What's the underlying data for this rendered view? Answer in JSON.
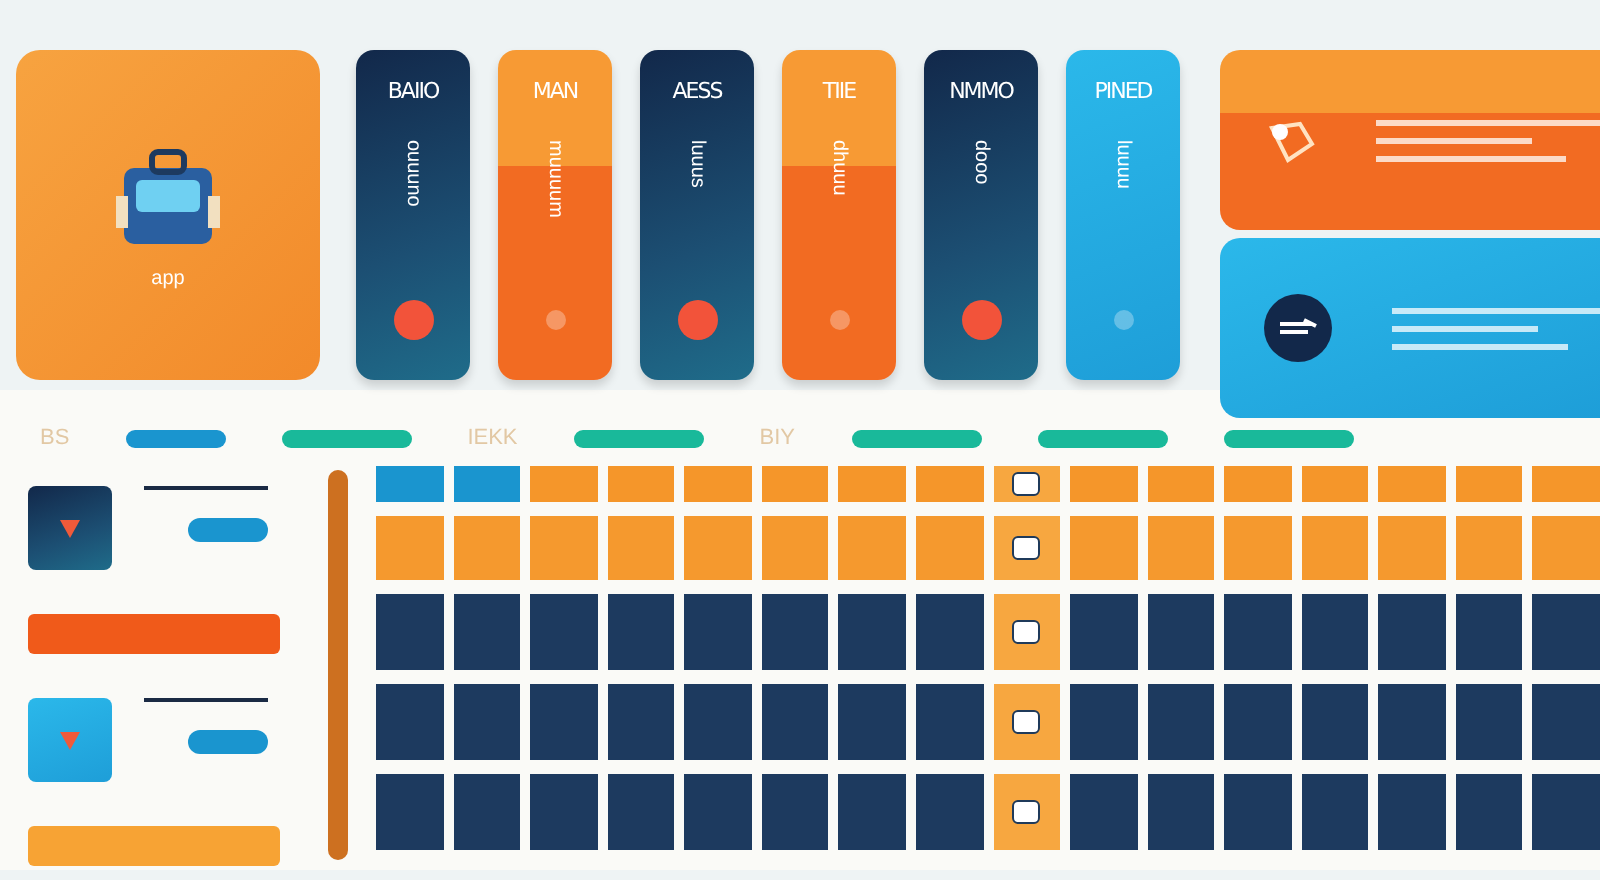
{
  "feature_card": {
    "title": "app"
  },
  "cards": [
    {
      "title": "BAIIO",
      "caption": "ouuuno",
      "kind": "navy",
      "active": true
    },
    {
      "title": "MAN",
      "caption": "muuuum",
      "kind": "orange",
      "active": false
    },
    {
      "title": "AESS",
      "caption": "luuus",
      "kind": "navy",
      "active": true
    },
    {
      "title": "TIIE",
      "caption": "dhuuu",
      "kind": "orange",
      "active": false
    },
    {
      "title": "NMMO",
      "caption": "dooo",
      "kind": "navy",
      "active": true
    },
    {
      "title": "PINED",
      "caption": "luuuu",
      "kind": "sky",
      "active": false
    }
  ],
  "panels": [
    {
      "kind": "orange"
    },
    {
      "kind": "sky"
    }
  ],
  "filter_bar": [
    {
      "kind": "label",
      "text": "BS"
    },
    {
      "kind": "pill",
      "selected": true
    },
    {
      "kind": "pill",
      "selected": false
    },
    {
      "kind": "label",
      "text": "IEKK"
    },
    {
      "kind": "pill",
      "selected": false
    },
    {
      "kind": "label",
      "text": "BIY"
    },
    {
      "kind": "pill",
      "selected": false
    },
    {
      "kind": "pill",
      "selected": false
    },
    {
      "kind": "pill",
      "selected": false
    }
  ],
  "sidebar": {
    "items": [
      {
        "kind": "navytile"
      },
      {
        "kind": "redbar"
      },
      {
        "kind": "skytile"
      },
      {
        "kind": "amberbar"
      }
    ]
  },
  "grid": {
    "rows": [
      {
        "kind": "head"
      },
      {
        "kind": "accent"
      },
      {
        "kind": "data"
      },
      {
        "kind": "data"
      },
      {
        "kind": "data"
      }
    ]
  }
}
